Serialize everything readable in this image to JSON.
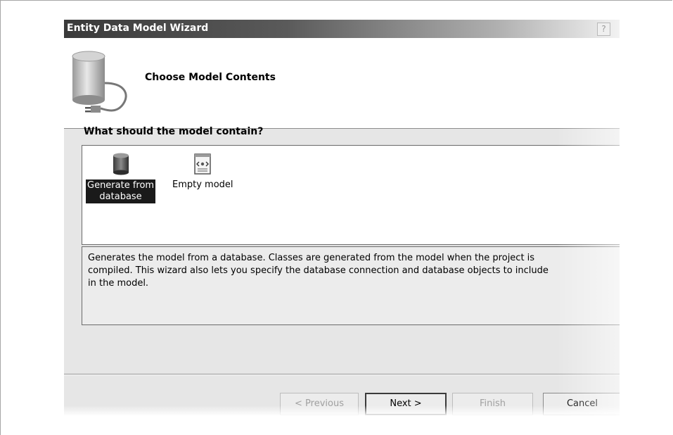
{
  "window": {
    "title": "Entity Data Model Wizard",
    "help_glyph": "?"
  },
  "banner": {
    "icon": "database-plug-icon",
    "title": "Choose Model Contents"
  },
  "question": "What should the model contain?",
  "model_options": [
    {
      "label": "Generate from\ndatabase",
      "icon": "database-icon",
      "selected": true
    },
    {
      "label": "Empty model",
      "icon": "empty-model-icon",
      "selected": false
    }
  ],
  "description": "Generates the model from a database. Classes are generated from the model when the project is\ncompiled.  This wizard also lets you specify the database connection and database objects to include\nin the model.",
  "buttons": {
    "previous": "< Previous",
    "next": "Next >",
    "finish": "Finish",
    "cancel": "Cancel"
  },
  "colors": {
    "selection": "#1a1a1a",
    "dialog_bg": "#e6e6e6",
    "title_dark": "#3a3a3a"
  }
}
